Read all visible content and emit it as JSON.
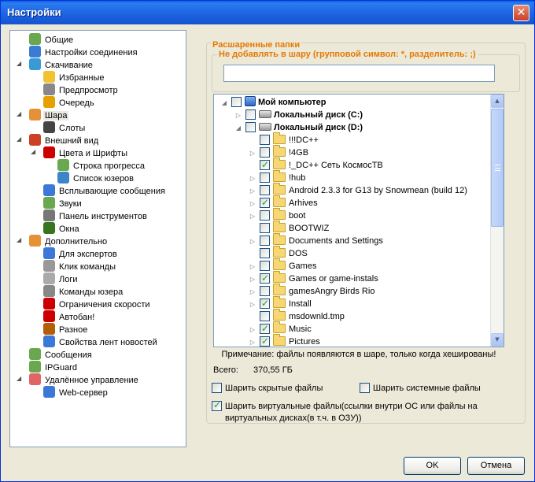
{
  "window": {
    "title": "Настройки",
    "close_glyph": "✕"
  },
  "sidebar": {
    "items": [
      {
        "label": "Общие",
        "icon": "general-icon",
        "color": "#6aa84f"
      },
      {
        "label": "Настройки соединения",
        "icon": "connection-icon",
        "color": "#3a7bd5"
      },
      {
        "label": "Скачивание",
        "icon": "download-icon",
        "color": "#3a9ad5"
      },
      {
        "label": "Избранные",
        "icon": "star-icon",
        "color": "#f1c232"
      },
      {
        "label": "Предпросмотр",
        "icon": "preview-icon",
        "color": "#888888"
      },
      {
        "label": "Очередь",
        "icon": "queue-icon",
        "color": "#e6a000"
      },
      {
        "label": "Шара",
        "icon": "share-icon",
        "color": "#e69138"
      },
      {
        "label": "Слоты",
        "icon": "slots-icon",
        "color": "#444444"
      },
      {
        "label": "Внешний вид",
        "icon": "appearance-icon",
        "color": "#cc4125"
      },
      {
        "label": "Цвета и Шрифты",
        "icon": "colors-fonts-icon",
        "color": "#cc0000"
      },
      {
        "label": "Строка прогресса",
        "icon": "progressbar-icon",
        "color": "#6aa84f"
      },
      {
        "label": "Список юзеров",
        "icon": "userlist-icon",
        "color": "#3d85c6"
      },
      {
        "label": "Всплывающие сообщения",
        "icon": "popup-icon",
        "color": "#3c78d8"
      },
      {
        "label": "Звуки",
        "icon": "sound-icon",
        "color": "#6aa84f"
      },
      {
        "label": "Панель инструментов",
        "icon": "toolbar-icon",
        "color": "#777777"
      },
      {
        "label": "Окна",
        "icon": "windows-icon",
        "color": "#38761d"
      },
      {
        "label": "Дополнительно",
        "icon": "advanced-icon",
        "color": "#e69138"
      },
      {
        "label": "Для экспертов",
        "icon": "experts-icon",
        "color": "#3c78d8"
      },
      {
        "label": "Клик команды",
        "icon": "click-icon",
        "color": "#999999"
      },
      {
        "label": "Логи",
        "icon": "logs-icon",
        "color": "#aaaaaa"
      },
      {
        "label": "Команды юзера",
        "icon": "usercommands-icon",
        "color": "#888888"
      },
      {
        "label": "Ограничения скорости",
        "icon": "speedlimit-icon",
        "color": "#cc0000"
      },
      {
        "label": "Автобан!",
        "icon": "autoban-icon",
        "color": "#cc0000"
      },
      {
        "label": "Разное",
        "icon": "misc-icon",
        "color": "#b45f06"
      },
      {
        "label": "Свойства лент новостей",
        "icon": "rss-icon",
        "color": "#3c78d8"
      },
      {
        "label": "Сообщения",
        "icon": "messages-icon",
        "color": "#6aa84f"
      },
      {
        "label": "IPGuard",
        "icon": "ipguard-icon",
        "color": "#6aa84f"
      },
      {
        "label": "Удалённое управление",
        "icon": "remote-icon",
        "color": "#e06666"
      },
      {
        "label": "Web-сервер",
        "icon": "webserver-icon",
        "color": "#3c78d8"
      }
    ],
    "selected_index": 6
  },
  "share": {
    "group_title": "Расшаренные папки",
    "exclude_title": "Не добавлять в шару (групповой символ: *, разделитель: ;)",
    "exclude_value": "",
    "tree": [
      {
        "label": "Мой компьютер",
        "type": "pc",
        "checked": false,
        "bold": true,
        "expanded": true
      },
      {
        "label": "Локальный диск (C:)",
        "type": "drive",
        "checked": false,
        "bold": true,
        "expanded": false
      },
      {
        "label": "Локальный диск (D:)",
        "type": "drive",
        "checked": false,
        "bold": true,
        "expanded": true
      },
      {
        "label": "!!!DC++",
        "type": "folder",
        "checked": false,
        "has_children": false
      },
      {
        "label": "!4GB",
        "type": "folder",
        "checked": false,
        "has_children": true
      },
      {
        "label": "!_DC++ Сеть КосмосТВ",
        "type": "folder",
        "checked": true,
        "has_children": false
      },
      {
        "label": "!hub",
        "type": "folder",
        "checked": false,
        "has_children": true
      },
      {
        "label": "Android 2.3.3 for G13 by Snowmean (build 12)",
        "type": "folder",
        "checked": false,
        "has_children": true
      },
      {
        "label": "Arhives",
        "type": "folder",
        "checked": true,
        "has_children": true
      },
      {
        "label": "boot",
        "type": "folder",
        "checked": false,
        "has_children": true
      },
      {
        "label": "BOOTWIZ",
        "type": "folder",
        "checked": false,
        "has_children": false
      },
      {
        "label": "Documents and Settings",
        "type": "folder",
        "checked": false,
        "has_children": true
      },
      {
        "label": "DOS",
        "type": "folder",
        "checked": false,
        "has_children": false
      },
      {
        "label": "Games",
        "type": "folder",
        "checked": false,
        "has_children": true
      },
      {
        "label": "Games or game-instals",
        "type": "folder",
        "checked": true,
        "has_children": true
      },
      {
        "label": "gamesAngry Birds Rio",
        "type": "folder",
        "checked": false,
        "has_children": true
      },
      {
        "label": "Install",
        "type": "folder",
        "checked": true,
        "has_children": true
      },
      {
        "label": "msdownld.tmp",
        "type": "folder",
        "checked": false,
        "has_children": false
      },
      {
        "label": "Music",
        "type": "folder",
        "checked": true,
        "has_children": true
      },
      {
        "label": "Pictures",
        "type": "folder",
        "checked": true,
        "has_children": true
      }
    ],
    "note": "Примечание: файлы появляются в шаре, только когда хешированы!",
    "total_label": "Всего:",
    "total_value": "370,55 ГБ",
    "options": {
      "hidden_files": {
        "label": "Шарить скрытые файлы",
        "checked": false
      },
      "system_files": {
        "label": "Шарить системные файлы",
        "checked": false
      },
      "virtual_files": {
        "label_line1": "Шарить виртуальные файлы(ссылки внутри ОС или файлы на",
        "label_line2": "виртуальных дисках(в т.ч. в ОЗУ))",
        "checked": true
      }
    }
  },
  "buttons": {
    "ok": "OK",
    "cancel": "Отмена"
  },
  "scrollbar": {
    "up_glyph": "▲",
    "down_glyph": "▼"
  }
}
